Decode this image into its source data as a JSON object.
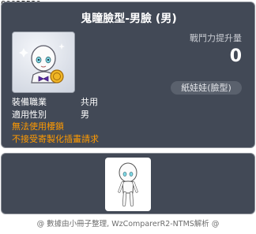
{
  "item_id": "00025530",
  "item_name": "鬼瞳臉型-男臉 (男)",
  "attack": {
    "label": "戰鬥力提升量",
    "value": "0"
  },
  "category": "紙娃娃(臉型)",
  "props": [
    {
      "key": "裝備職業",
      "value": "共用"
    },
    {
      "key": "適用性別",
      "value": "男"
    }
  ],
  "warnings": [
    "無法使用楆鎖",
    "不接受寄製化插畫請求"
  ],
  "footer": "@ 數據由小冊子整理, WzComparerR2-NTMS解析 @",
  "colors": {
    "panel": "#424956",
    "warning": "#ff9a00",
    "text": "#ffffff"
  },
  "icons": {
    "footer_left": "sparkle-icon",
    "footer_right": "sparkle-icon"
  }
}
